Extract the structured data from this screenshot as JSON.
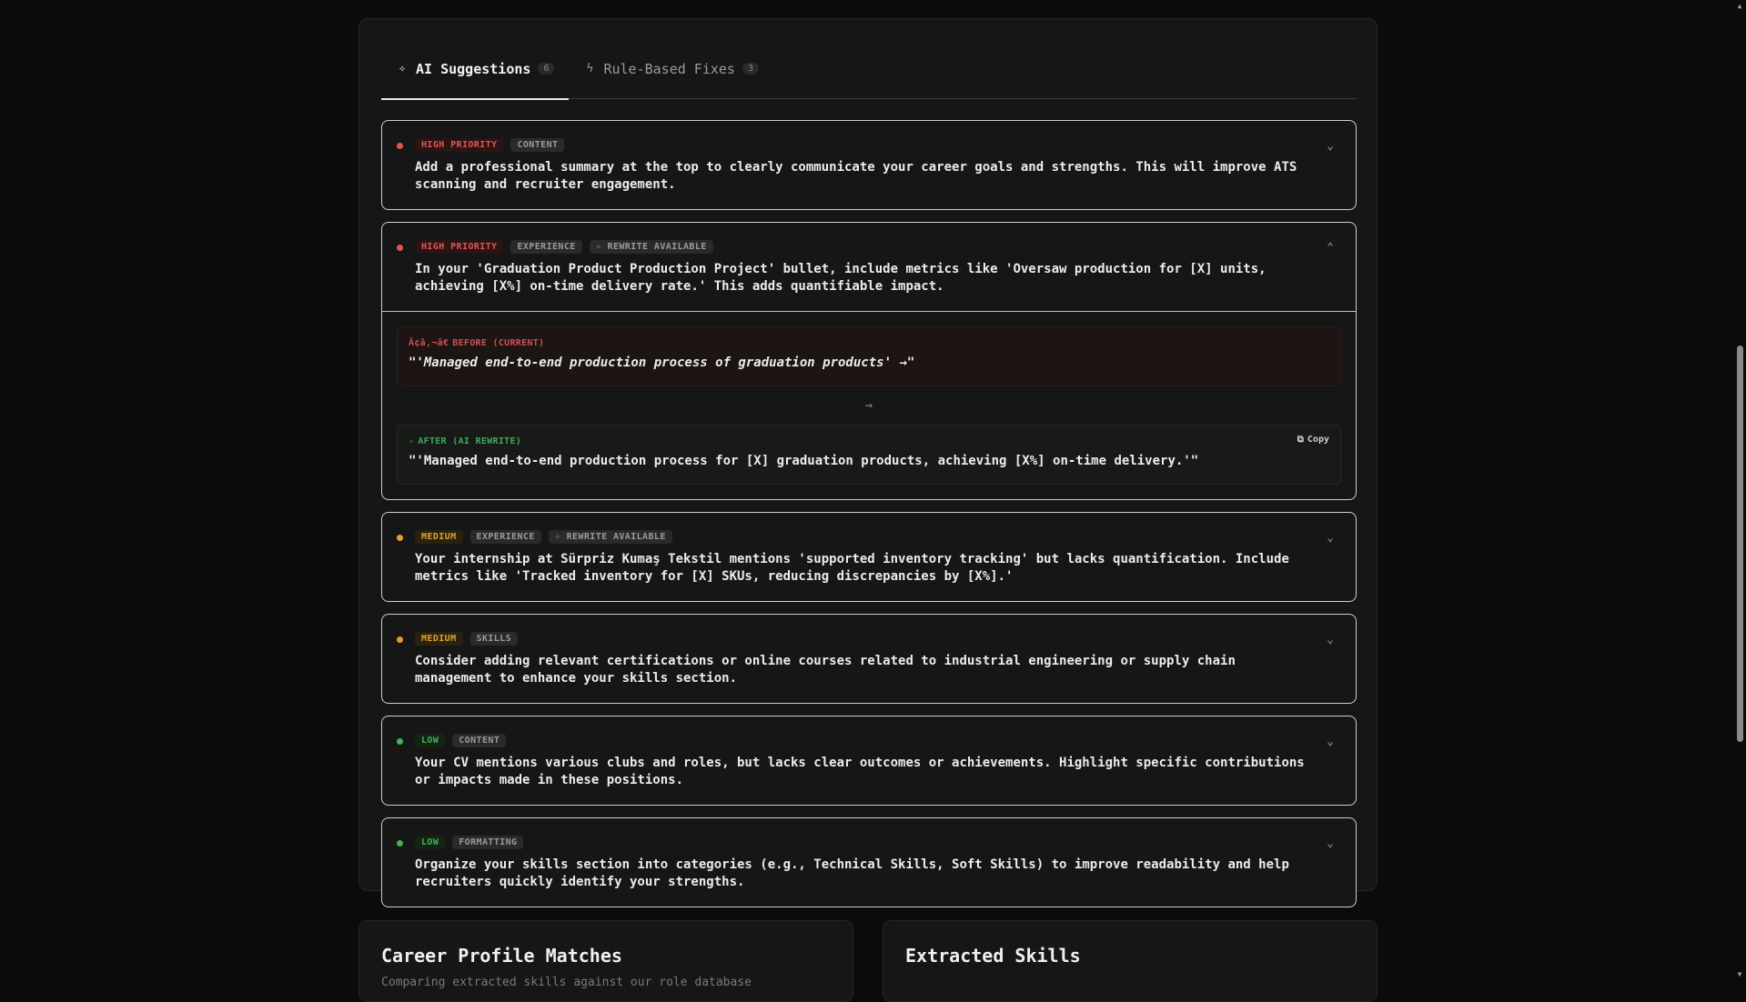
{
  "tabs": [
    {
      "label": "AI Suggestions",
      "count": "6",
      "icon": "sparkles-icon",
      "active": true
    },
    {
      "label": "Rule-Based Fixes",
      "count": "3",
      "icon": "bolt-icon",
      "active": false
    }
  ],
  "cards": [
    {
      "priority": "HIGH PRIORITY",
      "category": "CONTENT",
      "rewrite_badge": "",
      "text": "Add a professional summary at the top to clearly communicate your career goals and strengths. This will improve ATS scanning and recruiter engagement."
    },
    {
      "priority": "HIGH PRIORITY",
      "category": "EXPERIENCE",
      "rewrite_badge": "REWRITE AVAILABLE",
      "text": "In your 'Graduation Product Production Project' bullet, include metrics like 'Oversaw production for [X] units, achieving [X%] on-time delivery rate.' This adds quantifiable impact.",
      "before_label": "BEFORE (CURRENT)",
      "before_icon_text": "Ã¢â‚¬â€",
      "before_text": "\"'Managed end-to-end production process of graduation products' →\"",
      "after_label": "AFTER (AI REWRITE)",
      "after_text": "\"'Managed end-to-end production process for [X] graduation products, achieving [X%] on-time delivery.'\"",
      "copy_label": "Copy"
    },
    {
      "priority": "MEDIUM",
      "category": "EXPERIENCE",
      "rewrite_badge": "REWRITE AVAILABLE",
      "text": "Your internship at Sürpriz Kumaş Tekstil mentions 'supported inventory tracking' but lacks quantification. Include metrics like 'Tracked inventory for [X] SKUs, reducing discrepancies by [X%].'"
    },
    {
      "priority": "MEDIUM",
      "category": "SKILLS",
      "rewrite_badge": "",
      "text": "Consider adding relevant certifications or online courses related to industrial engineering or supply chain management to enhance your skills section."
    },
    {
      "priority": "LOW",
      "category": "CONTENT",
      "rewrite_badge": "",
      "text": "Your CV mentions various clubs and roles, but lacks clear outcomes or achievements. Highlight specific contributions or impacts made in these positions."
    },
    {
      "priority": "LOW",
      "category": "FORMATTING",
      "rewrite_badge": "",
      "text": "Organize your skills section into categories (e.g., Technical Skills, Soft Skills) to improve readability and help recruiters quickly identify your strengths."
    }
  ],
  "bottom": {
    "career_title": "Career Profile Matches",
    "career_sub": "Comparing extracted skills against our role database",
    "skills_title": "Extracted Skills"
  },
  "colors": {
    "high": "#e05555",
    "medium": "#e0a030",
    "low": "#3fb45a"
  }
}
